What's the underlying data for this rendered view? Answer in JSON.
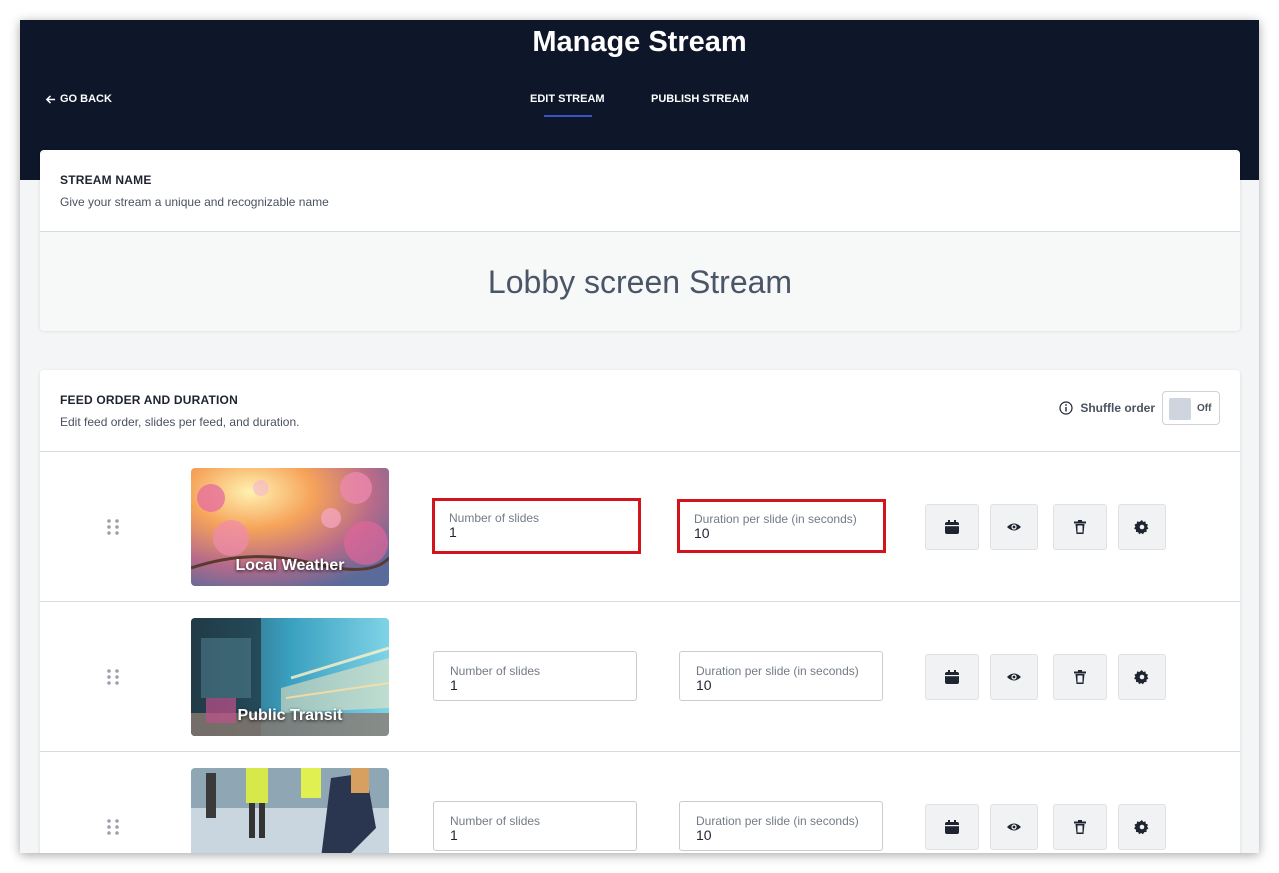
{
  "header": {
    "title": "Manage Stream",
    "go_back": "GO BACK",
    "tabs": [
      {
        "label": "EDIT STREAM",
        "active": true
      },
      {
        "label": "PUBLISH STREAM",
        "active": false
      }
    ]
  },
  "stream_name_section": {
    "title": "STREAM NAME",
    "subtitle": "Give your stream a unique and recognizable name",
    "value": "Lobby screen Stream"
  },
  "feeds_section": {
    "title": "FEED ORDER AND DURATION",
    "subtitle": "Edit feed order, slides per feed, and duration.",
    "shuffle_label": "Shuffle order",
    "shuffle_state": "Off",
    "feeds": [
      {
        "name": "Local Weather",
        "slides_label": "Number of slides",
        "slides": "1",
        "duration_label": "Duration per slide (in seconds)",
        "duration": "10",
        "highlighted": true
      },
      {
        "name": "Public Transit",
        "slides_label": "Number of slides",
        "slides": "1",
        "duration_label": "Duration per slide (in seconds)",
        "duration": "10",
        "highlighted": false
      },
      {
        "name": "",
        "slides_label": "Number of slides",
        "slides": "1",
        "duration_label": "Duration per slide (in seconds)",
        "duration": "10",
        "highlighted": false
      }
    ]
  },
  "icons": [
    "arrow-left-icon",
    "info-icon",
    "drag-handle-icon",
    "calendar-icon",
    "eye-icon",
    "trash-icon",
    "gear-icon"
  ],
  "colors": {
    "header_bg": "#0e1629",
    "tab_underline": "#3b52c7",
    "highlight_border": "#d3141c"
  }
}
